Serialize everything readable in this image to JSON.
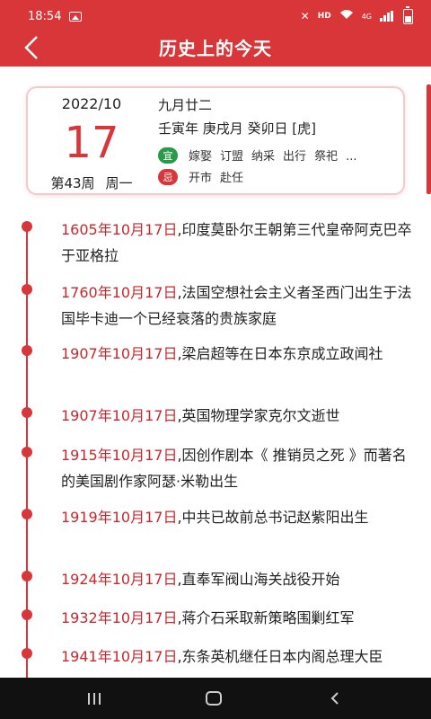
{
  "status_bar": {
    "time": "18:54",
    "network_label": "HD",
    "network_type": "4G"
  },
  "header": {
    "title": "历史上的今天",
    "back_icon": "chevron-left-icon"
  },
  "date_card": {
    "year_month": "2022/10",
    "day": "17",
    "week_number": "第43周",
    "weekday": "周一",
    "lunar_date": "九月廿二",
    "ganzhi": "壬寅年 庚戌月 癸卯日 [虎]",
    "yi_label": "宜",
    "yi_items": [
      "嫁娶",
      "订盟",
      "纳采",
      "出行",
      "祭祀",
      "..."
    ],
    "ji_label": "忌",
    "ji_items": [
      "开市",
      "赴任"
    ]
  },
  "events": [
    {
      "date": "1605年10月17日",
      "text": ",印度莫卧尔王朝第三代皇帝阿克巴卒于亚格拉"
    },
    {
      "date": "1760年10月17日",
      "text": ",法国空想社会主义者圣西门出生于法国毕卡迪一个已经衰落的贵族家庭"
    },
    {
      "date": "1907年10月17日",
      "text": ",梁启超等在日本东京成立政闻社"
    },
    {
      "date": "1907年10月17日",
      "text": ",英国物理学家克尔文逝世"
    },
    {
      "date": "1915年10月17日",
      "text": ",因创作剧本《 推销员之死 》而著名的美国剧作家阿瑟·米勒出生"
    },
    {
      "date": "1919年10月17日",
      "text": ",中共已故前总书记赵紫阳出生"
    },
    {
      "date": "1924年10月17日",
      "text": ",直奉军阀山海关战役开始"
    },
    {
      "date": "1932年10月17日",
      "text": ",蒋介石采取新策略围剿红军"
    },
    {
      "date": "1941年10月17日",
      "text": ",东条英机继任日本内阁总理大臣"
    }
  ],
  "colors": {
    "accent": "#d9363a",
    "date_text": "#c8272d",
    "yi_badge": "#2a9a48",
    "ji_badge": "#d9363a"
  }
}
